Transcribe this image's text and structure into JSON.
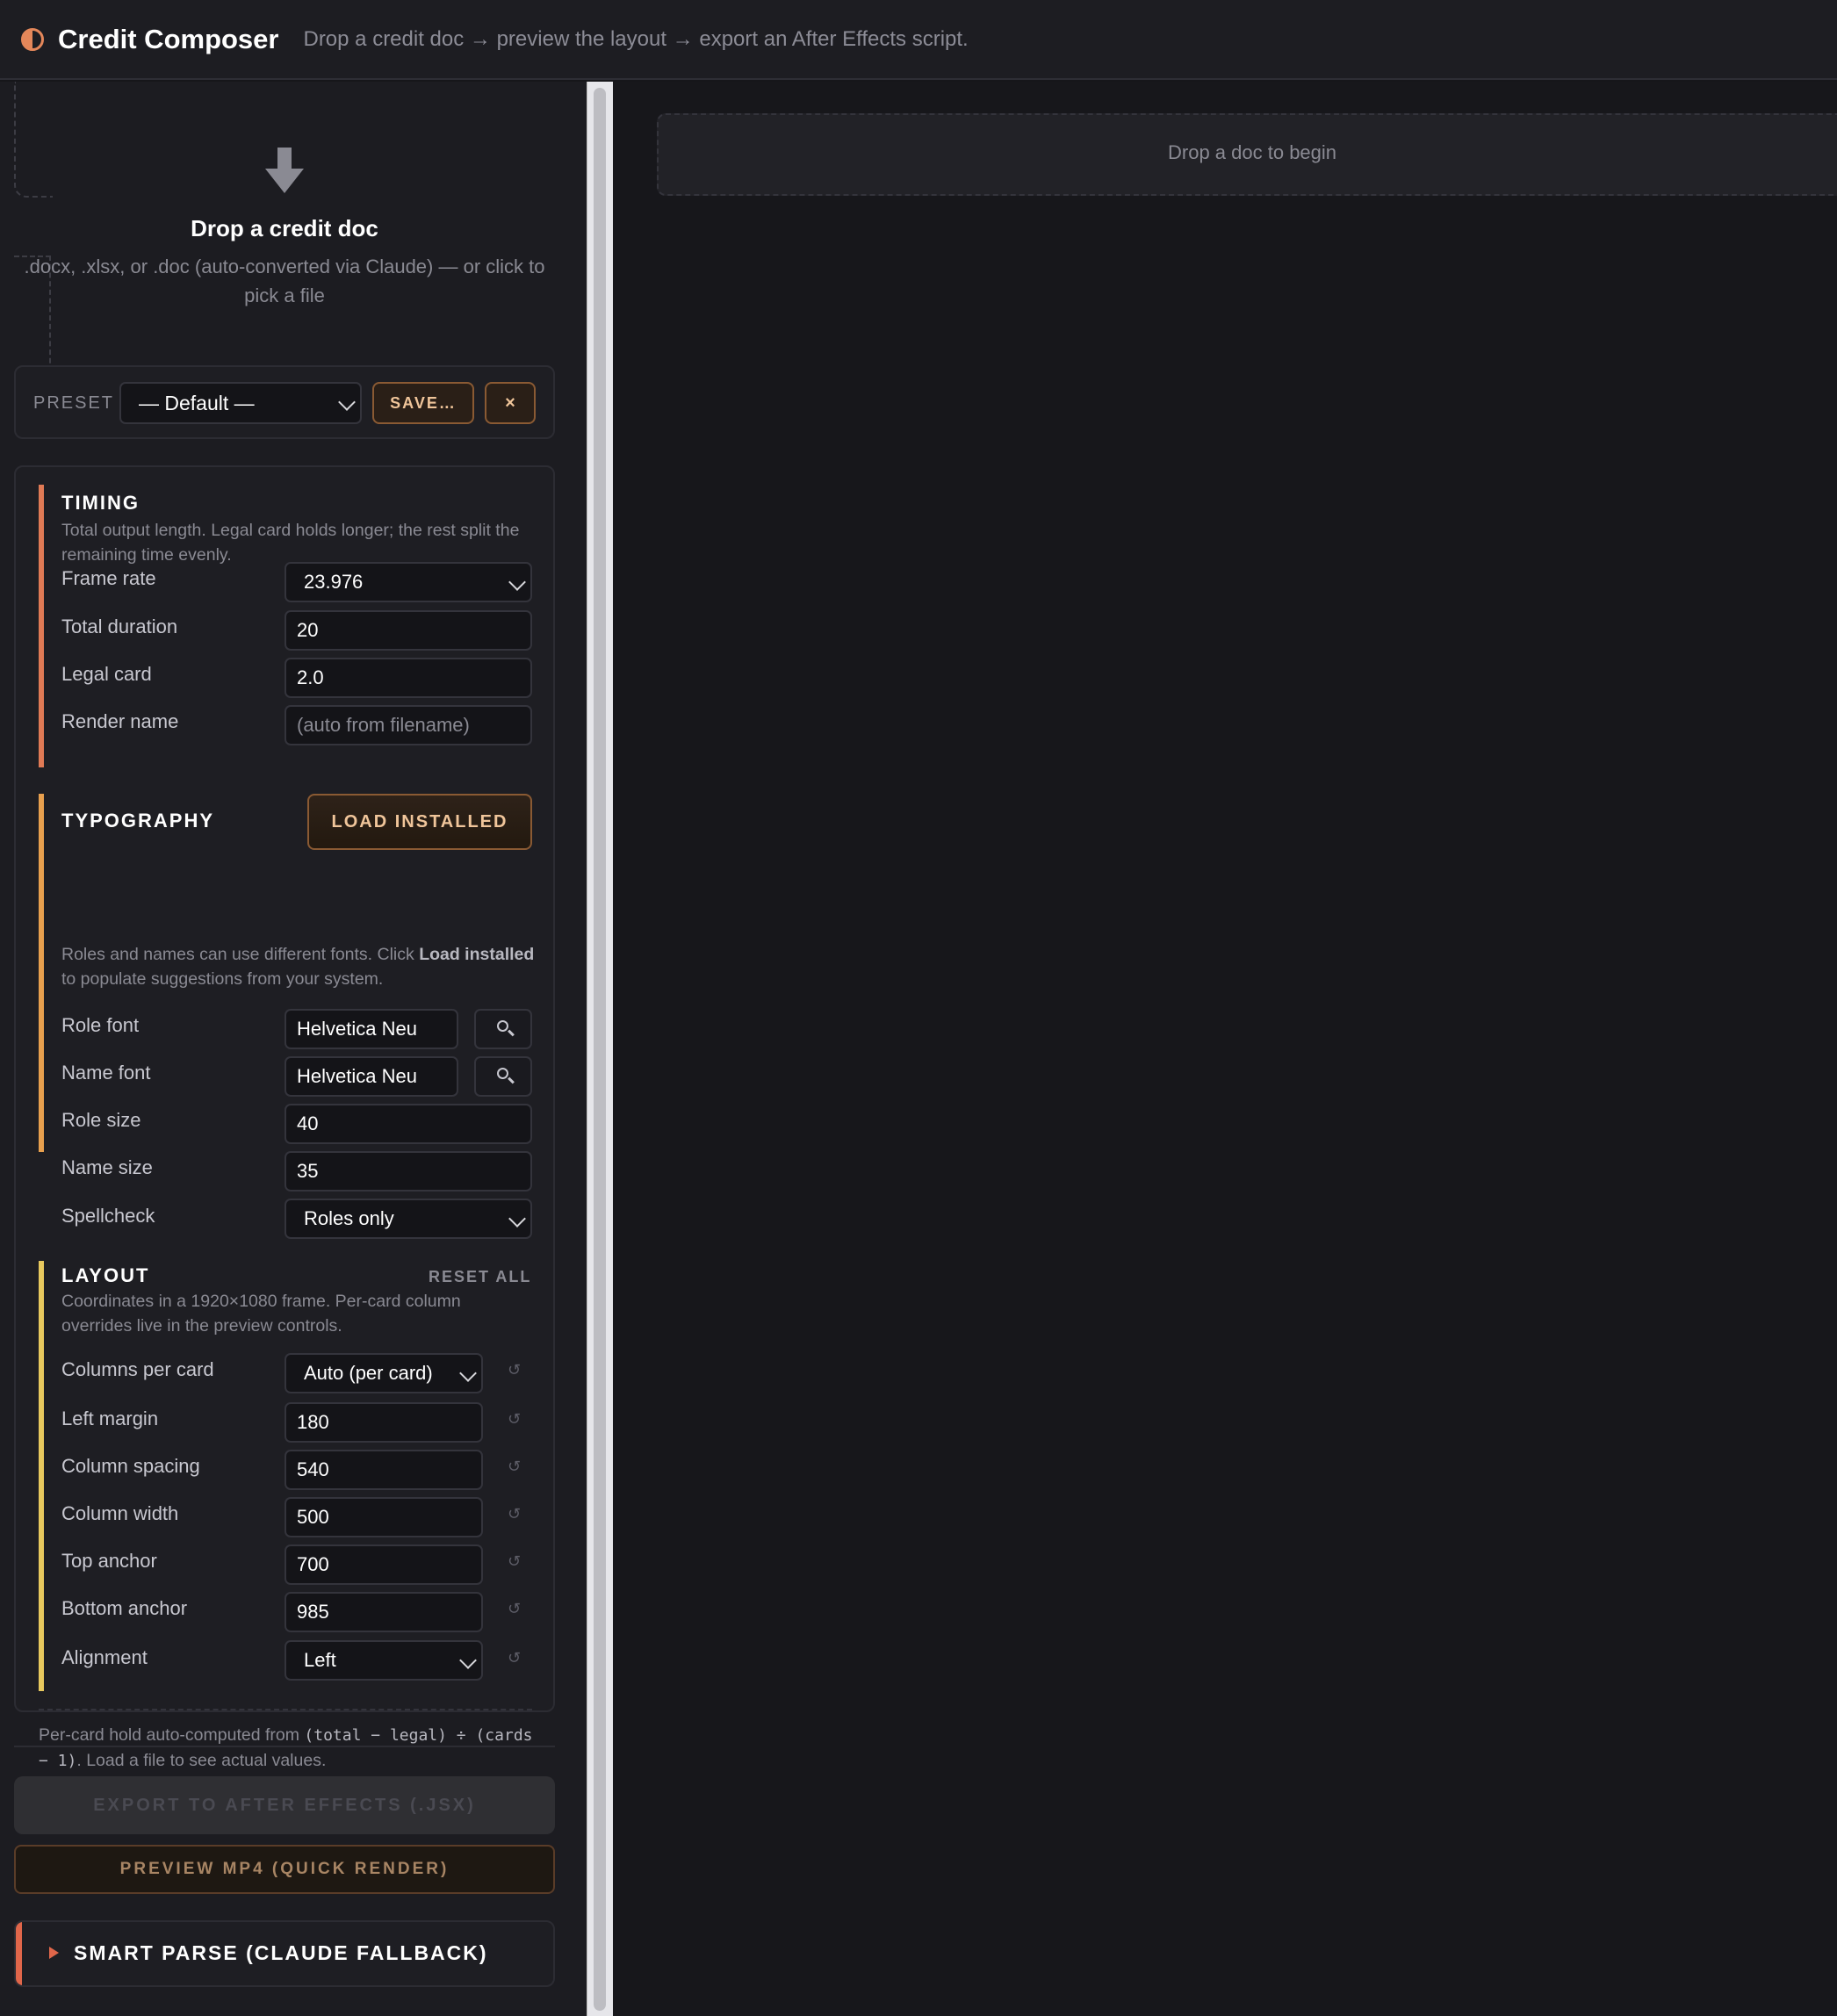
{
  "header": {
    "title": "Credit Composer",
    "subtitle": "Drop a credit doc → preview the layout → export an After Effects script."
  },
  "drop": {
    "title": "Drop a credit doc",
    "subtitle": ".docx, .xlsx, or .doc (auto-converted via Claude) — or click to pick a file"
  },
  "preset": {
    "label": "PRESET",
    "selected": "— Default —",
    "save_label": "SAVE…",
    "delete_label": "×"
  },
  "timing": {
    "title": "TIMING",
    "description": "Total output length. Legal card holds longer; the rest split the remaining time evenly.",
    "frame_rate_label": "Frame rate",
    "frame_rate_value": "23.976",
    "total_duration_label": "Total duration",
    "total_duration_value": "20",
    "legal_card_label": "Legal card",
    "legal_card_value": "2.0",
    "render_name_label": "Render name",
    "render_name_placeholder": "(auto from filename)"
  },
  "typography": {
    "title": "TYPOGRAPHY",
    "load_label": "LOAD INSTALLED",
    "desc_pre": "Roles and names can use different fonts. Click ",
    "desc_bold": "Load installed",
    "desc_post": " to populate suggestions from your system.",
    "role_font_label": "Role font",
    "role_font_value": "Helvetica Neu",
    "name_font_label": "Name font",
    "name_font_value": "Helvetica Neu",
    "role_size_label": "Role size",
    "role_size_value": "40",
    "name_size_label": "Name size",
    "name_size_value": "35",
    "spellcheck_label": "Spellcheck",
    "spellcheck_value": "Roles only"
  },
  "layout": {
    "title": "LAYOUT",
    "reset_all_label": "RESET ALL",
    "description": "Coordinates in a 1920×1080 frame. Per-card column overrides live in the preview controls.",
    "rows": [
      {
        "label": "Columns per card",
        "value": "Auto (per card)"
      },
      {
        "label": "Left margin",
        "value": "180"
      },
      {
        "label": "Column spacing",
        "value": "540"
      },
      {
        "label": "Column width",
        "value": "500"
      },
      {
        "label": "Top anchor",
        "value": "700"
      },
      {
        "label": "Bottom anchor",
        "value": "985"
      },
      {
        "label": "Alignment",
        "value": "Left"
      }
    ],
    "reset_icon": "↺"
  },
  "footnote": {
    "pre": "Per-card hold auto-computed from ",
    "code1": "(total − legal) ÷ (cards − 1)",
    "post": ". Load a file to see actual values."
  },
  "actions": {
    "export_label": "EXPORT TO AFTER EFFECTS (.JSX)",
    "preview_label": "PREVIEW MP4 (QUICK RENDER)",
    "smart_parse_label": "SMART PARSE (CLAUDE FALLBACK)"
  },
  "main": {
    "placeholder": "Drop a doc to begin"
  },
  "colors": {
    "accent": "#e4875a",
    "timing_bar": "#e07a55",
    "typography_bar": "#e8a04e",
    "layout_bar": "#e8c95e"
  }
}
